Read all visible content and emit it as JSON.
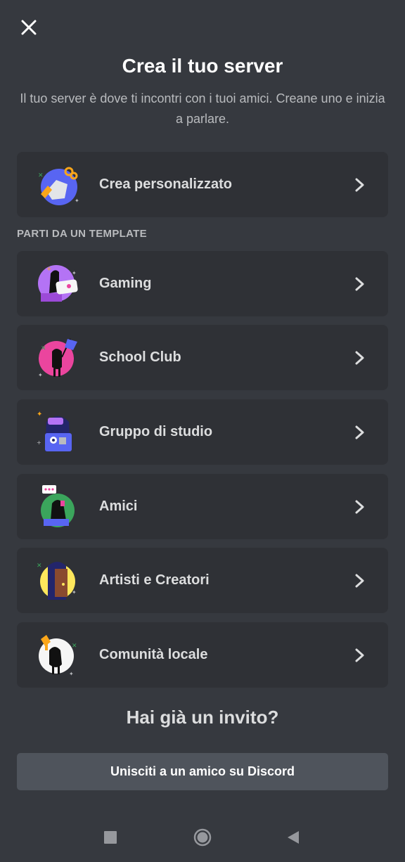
{
  "header": {
    "title": "Crea il tuo server",
    "subtitle": "Il tuo server è dove ti incontri con i tuoi amici. Creane uno e inizia a parlare."
  },
  "custom": {
    "label": "Crea personalizzato",
    "icon": "globe-build-icon"
  },
  "templates_header": "PARTI DA UN TEMPLATE",
  "templates": [
    {
      "label": "Gaming",
      "icon": "gaming-icon"
    },
    {
      "label": "School Club",
      "icon": "school-club-icon"
    },
    {
      "label": "Gruppo di studio",
      "icon": "backpack-icon"
    },
    {
      "label": "Amici",
      "icon": "friends-icon"
    },
    {
      "label": "Artisti e Creatori",
      "icon": "artist-door-icon"
    },
    {
      "label": "Comunità locale",
      "icon": "local-community-icon"
    }
  ],
  "invite": {
    "title": "Hai già un invito?",
    "button_label": "Unisciti a un amico su Discord"
  },
  "colors": {
    "background": "#36393f",
    "card": "#2f3136",
    "button": "#4f545c",
    "muted_text": "#b9bbbe"
  }
}
